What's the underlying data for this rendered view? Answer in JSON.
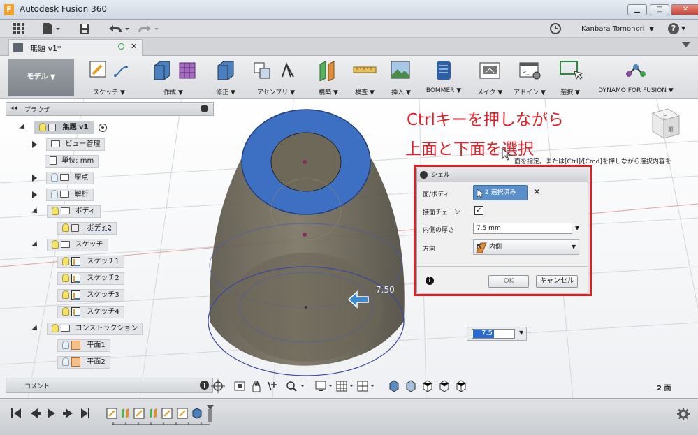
{
  "app": {
    "title": "Autodesk Fusion 360",
    "logo_letter": "F"
  },
  "window_controls": {
    "minimize": "▁",
    "maximize": "□",
    "close": "✕"
  },
  "qat": {
    "user": "Kanbara Tomonori",
    "user_caret": "▼",
    "help": "?",
    "help_caret": "▼"
  },
  "document_tab": {
    "name": "無題 v1*",
    "close": "✕"
  },
  "ribbon": {
    "workspace": "モデル ▼",
    "groups": [
      {
        "label": "スケッチ ▼"
      },
      {
        "label": "作成 ▼"
      },
      {
        "label": "修正 ▼"
      },
      {
        "label": "アセンブリ ▼"
      },
      {
        "label": "構築 ▼"
      },
      {
        "label": "検査 ▼"
      },
      {
        "label": "挿入 ▼"
      },
      {
        "label": "BOMMER ▼"
      },
      {
        "label": "メイク ▼"
      },
      {
        "label": "アドイン ▼"
      },
      {
        "label": "選択 ▼"
      },
      {
        "label": "DYNAMO FOR FUSION ▼"
      }
    ]
  },
  "browser": {
    "title": "ブラウザ",
    "collapse": "◂◂",
    "root": "無題 v1",
    "items": [
      {
        "label": "ビュー管理"
      },
      {
        "label": "単位: mm"
      },
      {
        "label": "原点"
      },
      {
        "label": "解析"
      },
      {
        "label": "ボディ"
      },
      {
        "label": "ボディ2"
      },
      {
        "label": "スケッチ"
      },
      {
        "label": "スケッチ1"
      },
      {
        "label": "スケッチ2"
      },
      {
        "label": "スケッチ3"
      },
      {
        "label": "スケッチ4"
      },
      {
        "label": "コンストラクション"
      },
      {
        "label": "平面1"
      },
      {
        "label": "平面2"
      }
    ]
  },
  "annotation": {
    "line1": "Ctrlキーを押しながら",
    "line2": "上面と下面を選択"
  },
  "tooltip": "面を指定。または[Ctrl]/[Cmd]を押しながら選択内容を",
  "viewcube": {
    "top": "上",
    "front": "前"
  },
  "dimension": {
    "value": "7.50",
    "input_value": "7.5",
    "input_caret": "▼"
  },
  "shell_dialog": {
    "title": "シェル",
    "face_label": "面/ボディ",
    "face_value": "2 選択済み",
    "face_clear": "✕",
    "tangent_label": "接面チェーン",
    "tangent_checked": "✓",
    "thickness_label": "内側の厚さ",
    "thickness_value": "7.5 mm",
    "thickness_caret": "▼",
    "direction_label": "方向",
    "direction_value": "内側",
    "direction_caret": "▼",
    "info": "i",
    "ok": "OK",
    "cancel": "キャンセル"
  },
  "comment_bar": {
    "label": "コメント",
    "add": "+"
  },
  "status": {
    "selection": "2 面"
  },
  "colors": {
    "selected_face": "#3d6fc2",
    "body": "#6b6556",
    "annotation": "#e0202a",
    "dialog_border": "#e02020"
  }
}
